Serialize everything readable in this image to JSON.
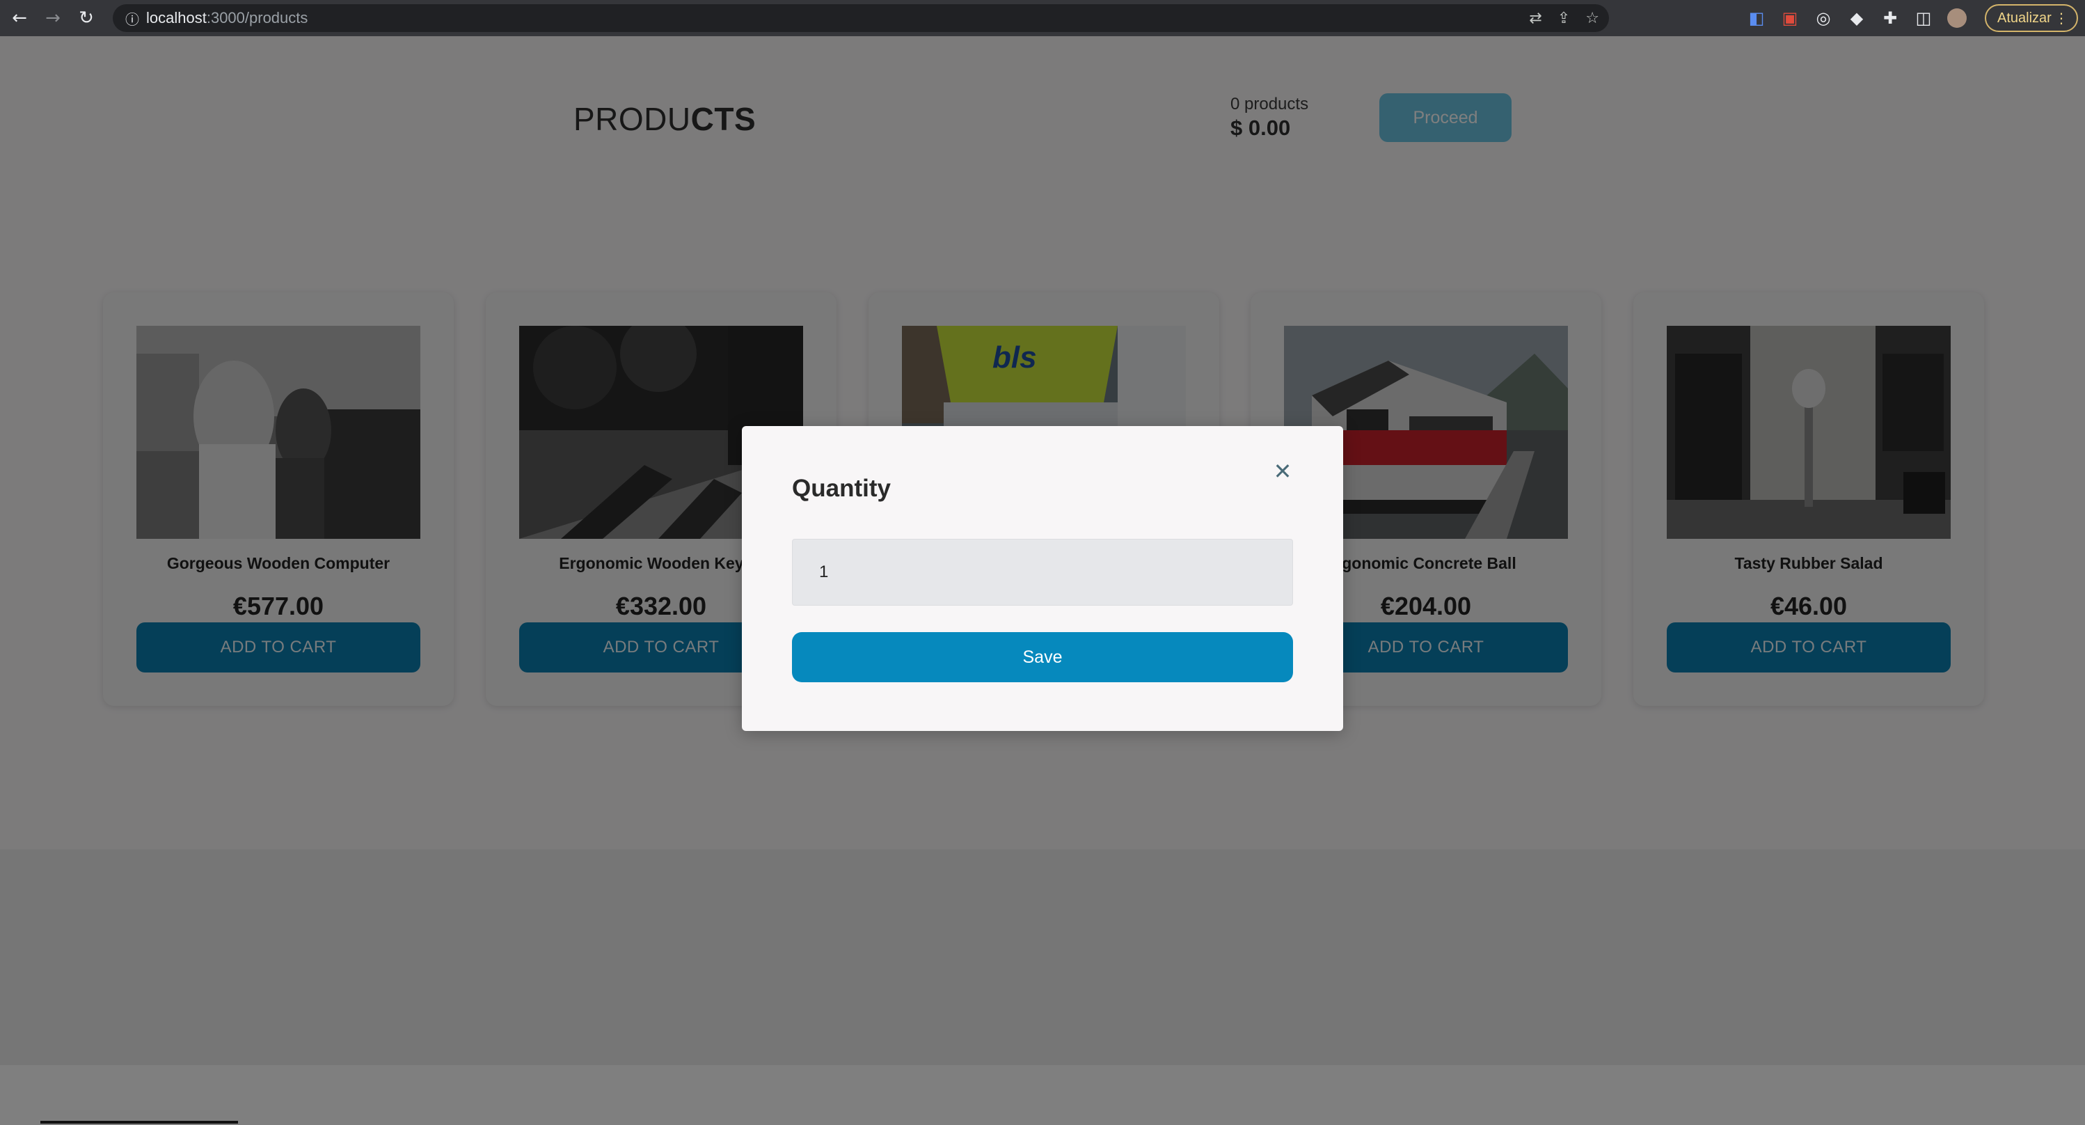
{
  "browser": {
    "url_host": "localhost",
    "url_path": ":3000/products",
    "update_label": "Atualizar"
  },
  "header": {
    "logo_light": "PRODU",
    "logo_bold": "CTS",
    "cart_count": "0 products",
    "cart_total": "$ 0.00",
    "proceed_label": "Proceed"
  },
  "products": [
    {
      "name": "Gorgeous Wooden Computer",
      "price": "€577.00",
      "button": "ADD TO CART"
    },
    {
      "name": "Ergonomic Wooden Keybo",
      "price": "€332.00",
      "button": "ADD TO CART"
    },
    {
      "name": "",
      "price": "",
      "button": ""
    },
    {
      "name": "rgonomic Concrete Ball",
      "price": "€204.00",
      "button": "ADD TO CART"
    },
    {
      "name": "Tasty Rubber Salad",
      "price": "€46.00",
      "button": "ADD TO CART"
    }
  ],
  "modal": {
    "title": "Quantity",
    "quantity_value": "1",
    "save_label": "Save"
  },
  "colors": {
    "primary": "#0689bd",
    "proceed": "#6bc3e0",
    "card_button": "#0b7fb0"
  }
}
